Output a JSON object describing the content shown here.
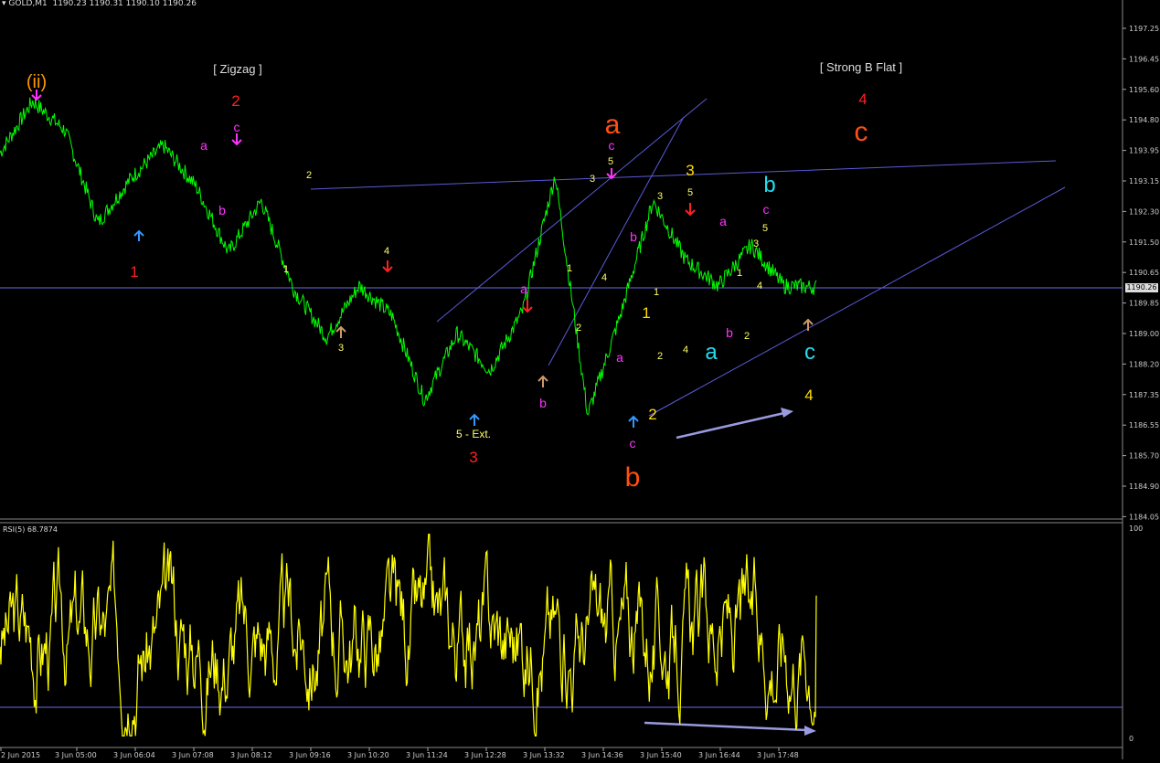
{
  "header": {
    "symbol": "GOLD,M1",
    "ohlc": "1190.23 1190.31 1190.10 1190.26"
  },
  "price_axis": [
    "1197.25",
    "1196.45",
    "1195.60",
    "1194.80",
    "1193.95",
    "1193.15",
    "1192.30",
    "1191.50",
    "1190.65",
    "1189.85",
    "1189.00",
    "1188.20",
    "1187.35",
    "1186.55",
    "1185.70",
    "1184.90",
    "1184.05"
  ],
  "current_price": "1190.26",
  "rsi_header": "RSI(5) 68.7874",
  "rsi_axis": [
    "100",
    "0"
  ],
  "time_axis": [
    "2 Jun 2015",
    "3 Jun 05:00",
    "3 Jun 06:04",
    "3 Jun 07:08",
    "3 Jun 08:12",
    "3 Jun 09:16",
    "3 Jun 10:20",
    "3 Jun 11:24",
    "3 Jun 12:28",
    "3 Jun 13:32",
    "3 Jun 14:36",
    "3 Jun 15:40",
    "3 Jun 16:44",
    "3 Jun 17:48"
  ],
  "annotations": {
    "zigzag": "[ Zigzag ]",
    "strong_b_flat": "[ Strong B Flat ]",
    "ii": "(ii)",
    "w1": "1",
    "w2": "2",
    "w3": "3",
    "w4": "4",
    "wc_big": "c",
    "big_a": "a",
    "big_b": "b",
    "ext5": "5 - Ext."
  },
  "chart_data": [
    {
      "type": "line",
      "title": "GOLD,M1",
      "x": [
        "3 Jun 05:00",
        "3 Jun 06:04",
        "3 Jun 07:08",
        "3 Jun 08:12",
        "3 Jun 09:16",
        "3 Jun 10:20",
        "3 Jun 11:24",
        "3 Jun 12:28",
        "3 Jun 13:32",
        "3 Jun 14:36",
        "3 Jun 15:40",
        "3 Jun 16:44",
        "3 Jun 17:48"
      ],
      "ylim": [
        1184.05,
        1197.6
      ],
      "series": [
        {
          "color": "#00ff00",
          "values": [
            1193.9,
            1195.3,
            1194.5,
            1192.0,
            1193.2,
            1194.1,
            1193.0,
            1191.2,
            1192.6,
            1190.2,
            1188.9,
            1190.3,
            1189.5,
            1187.2,
            1189.0,
            1188.0,
            1189.6,
            1193.3,
            1186.8,
            1189.5,
            1192.6,
            1191.0,
            1190.3,
            1191.4,
            1190.3,
            1190.26
          ]
        }
      ]
    },
    {
      "type": "line",
      "title": "RSI(5) 68.7874",
      "ylim": [
        0,
        100
      ],
      "series": [
        {
          "color": "#ffff00",
          "values": [
            68.79
          ]
        }
      ]
    }
  ],
  "colors": {
    "price": "#00ff00",
    "rsi": "#ffff00",
    "trend_line": "#5a5ad8"
  }
}
